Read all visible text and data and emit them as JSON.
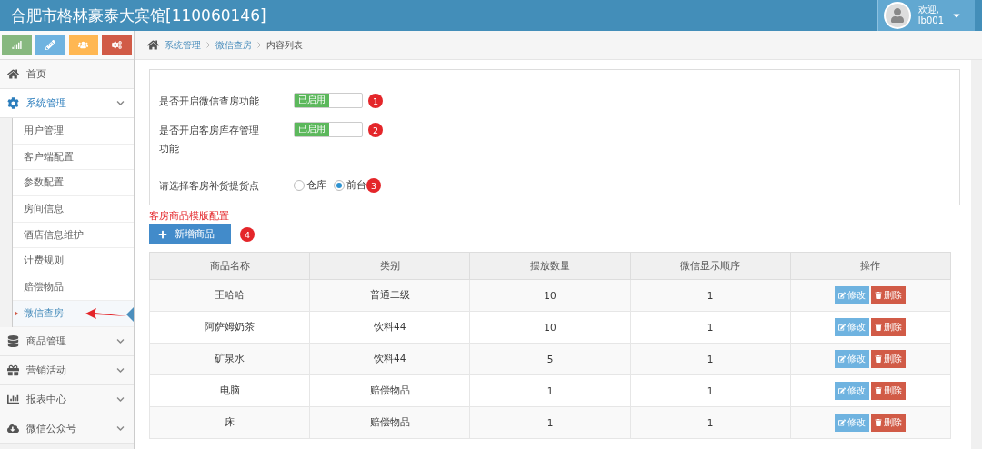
{
  "header": {
    "title": "合肥市格林豪泰大宾馆[110060146]",
    "greeting": "欢迎,",
    "username": "lb001"
  },
  "shortcuts": [
    {
      "kind": "chart",
      "color": "#87b87f"
    },
    {
      "kind": "pencil",
      "color": "#6fb3e0"
    },
    {
      "kind": "users",
      "color": "#ffb752"
    },
    {
      "kind": "cogs",
      "color": "#d15b47"
    }
  ],
  "sidebar": {
    "items": [
      {
        "kind": "home",
        "label": "首页"
      },
      {
        "kind": "gear",
        "label": "系统管理",
        "expanded": true,
        "children": [
          {
            "label": "用户管理",
            "selected": false
          },
          {
            "label": "客户端配置",
            "selected": false
          },
          {
            "label": "参数配置",
            "selected": false
          },
          {
            "label": "房间信息",
            "selected": false
          },
          {
            "label": "酒店信息维护",
            "selected": false
          },
          {
            "label": "计费规则",
            "selected": false
          },
          {
            "label": "赔偿物品",
            "selected": false
          },
          {
            "label": "微信查房",
            "selected": true
          }
        ]
      },
      {
        "kind": "database",
        "label": "商品管理",
        "expanded": false
      },
      {
        "kind": "gift",
        "label": "营销活动",
        "expanded": false
      },
      {
        "kind": "chart",
        "label": "报表中心",
        "expanded": false
      },
      {
        "kind": "cloud",
        "label": "微信公众号",
        "expanded": false
      }
    ]
  },
  "breadcrumb": [
    {
      "label": "系统管理",
      "link": true
    },
    {
      "label": "微信查房",
      "link": true
    },
    {
      "label": "内容列表",
      "link": false
    }
  ],
  "settings": [
    {
      "kind": "toggle",
      "label": "是否开启微信查房功能",
      "on": true,
      "state_text": "已启用",
      "badge": "1"
    },
    {
      "kind": "toggle",
      "label": "是否开启客房库存管理功能",
      "on": true,
      "state_text": "已启用",
      "badge": "2"
    },
    {
      "kind": "radio",
      "label": "请选择客房补货提货点",
      "options": [
        {
          "label": "仓库",
          "selected": false
        },
        {
          "label": "前台",
          "selected": true
        }
      ],
      "badge": "3"
    }
  ],
  "section_title": "客房商品模版配置",
  "add_button": {
    "label": "新增商品",
    "badge": "4"
  },
  "table": {
    "columns": [
      "商品名称",
      "类别",
      "摆放数量",
      "微信显示顺序",
      "操作"
    ],
    "rows": [
      {
        "cells": [
          "王哈哈",
          "普通二级",
          "10",
          "1"
        ],
        "actions": [
          "修改",
          "删除"
        ]
      },
      {
        "cells": [
          "阿萨姆奶茶",
          "饮料44",
          "10",
          "1"
        ],
        "actions": [
          "修改",
          "删除"
        ]
      },
      {
        "cells": [
          "矿泉水",
          "饮料44",
          "5",
          "1"
        ],
        "actions": [
          "修改",
          "删除"
        ]
      },
      {
        "cells": [
          "电脑",
          "赔偿物品",
          "1",
          "1"
        ],
        "actions": [
          "修改",
          "删除"
        ]
      },
      {
        "cells": [
          "床",
          "赔偿物品",
          "1",
          "1"
        ],
        "actions": [
          "修改",
          "删除"
        ]
      }
    ]
  }
}
